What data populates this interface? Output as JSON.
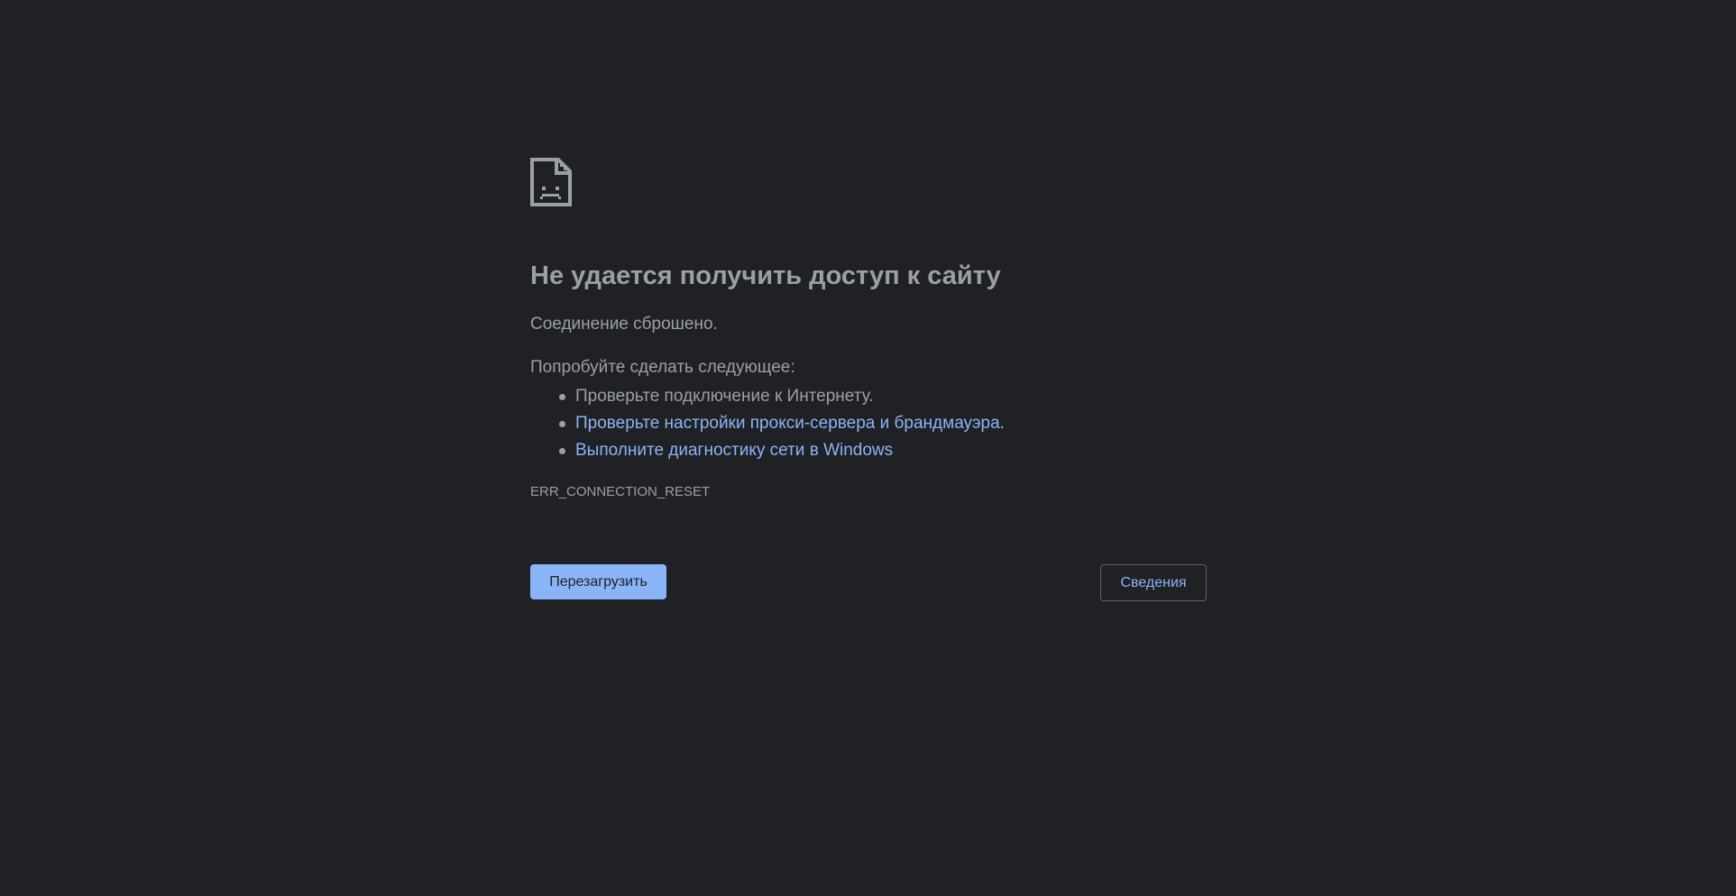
{
  "error_page": {
    "icon": "sad-document-icon",
    "heading": "Не удается получить доступ к сайту",
    "subtitle": "Соединение сброшено.",
    "suggestions_title": "Попробуйте сделать следующее:",
    "suggestions": [
      {
        "text": "Проверьте подключение к Интернету.",
        "is_link": false
      },
      {
        "text": "Проверьте настройки прокси-сервера и брандмауэра.",
        "is_link": true
      },
      {
        "text": "Выполните диагностику сети в Windows",
        "is_link": true
      }
    ],
    "error_code": "ERR_CONNECTION_RESET",
    "reload_button": "Перезагрузить",
    "details_button": "Сведения"
  },
  "colors": {
    "background": "#202124",
    "text": "#9aa0a6",
    "link": "#8ab4f8",
    "primary_button": "#8ab4f8",
    "border": "#5f6368"
  }
}
